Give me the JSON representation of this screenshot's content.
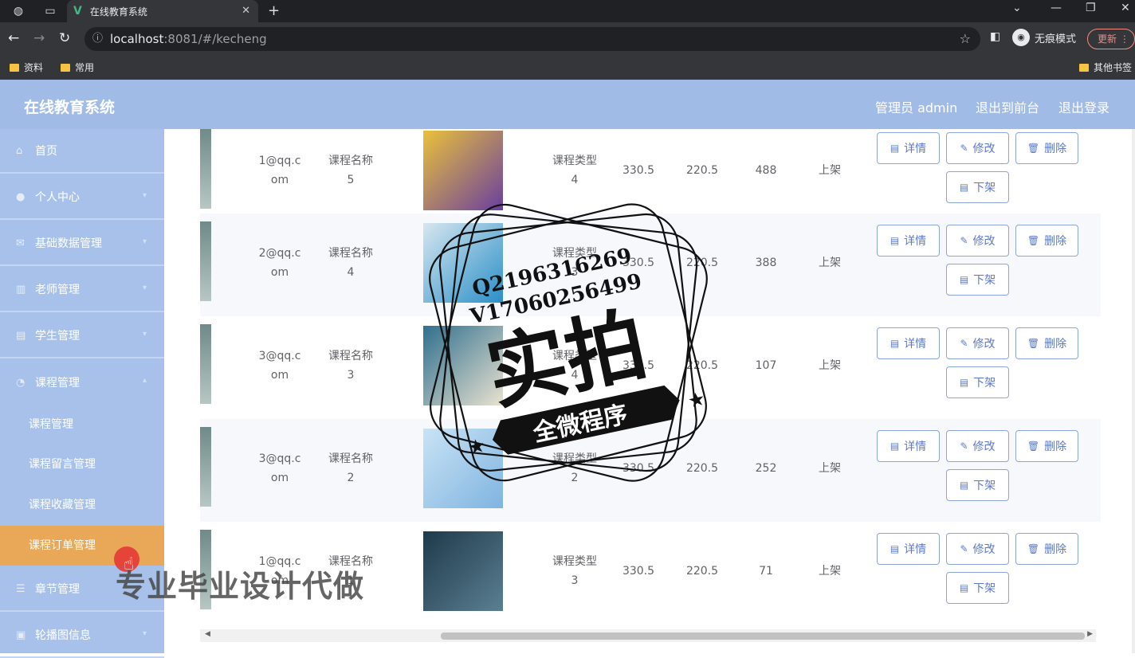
{
  "browser": {
    "tab_title": "在线教育系统",
    "url_host": "localhost",
    "url_rest": ":8081/#/kecheng",
    "incognito_label": "无痕模式",
    "update_label": "更新",
    "bookmarks": [
      "资料",
      "常用"
    ],
    "other_bookmarks": "其他书签"
  },
  "header": {
    "title": "在线教育系统",
    "user": "管理员 admin",
    "to_front": "退出到前台",
    "logout": "退出登录"
  },
  "sidebar": {
    "items": [
      {
        "label": "首页",
        "icon": "home-icon"
      },
      {
        "label": "个人中心",
        "icon": "user-icon"
      },
      {
        "label": "基础数据管理",
        "icon": "mail-icon"
      },
      {
        "label": "老师管理",
        "icon": "chart-icon"
      },
      {
        "label": "学生管理",
        "icon": "card-icon"
      },
      {
        "label": "课程管理",
        "icon": "clock-icon"
      }
    ],
    "sub_items": [
      "课程管理",
      "课程留言管理",
      "课程收藏管理",
      "课程订单管理"
    ],
    "after_items": [
      {
        "label": "章节管理",
        "icon": "menu-icon"
      },
      {
        "label": "轮播图信息",
        "icon": "image-icon"
      }
    ]
  },
  "table": {
    "rows": [
      {
        "email": [
          "1@qq.c",
          "om"
        ],
        "name": [
          "课程名称",
          "5"
        ],
        "type": [
          "课程类型",
          "4"
        ],
        "price": "330.5",
        "sale_price": "220.5",
        "clicks": "488",
        "status": "上架",
        "img_color": [
          "#e9c13a",
          "#6a3f9f"
        ]
      },
      {
        "email": [
          "2@qq.c",
          "om"
        ],
        "name": [
          "课程名称",
          "4"
        ],
        "type": [
          "课程类型",
          "3"
        ],
        "price": "330.5",
        "sale_price": "220.5",
        "clicks": "388",
        "status": "上架",
        "img_color": [
          "#d7e6ef",
          "#2a8fc8"
        ]
      },
      {
        "email": [
          "3@qq.c",
          "om"
        ],
        "name": [
          "课程名称",
          "3"
        ],
        "type": [
          "课程类型",
          "4"
        ],
        "price": "330.5",
        "sale_price": "220.5",
        "clicks": "107",
        "status": "上架",
        "img_color": [
          "#2f6f8e",
          "#e9e2d0"
        ]
      },
      {
        "email": [
          "3@qq.c",
          "om"
        ],
        "name": [
          "课程名称",
          "2"
        ],
        "type": [
          "课程类型",
          "2"
        ],
        "price": "330.5",
        "sale_price": "220.5",
        "clicks": "252",
        "status": "上架",
        "img_color": [
          "#c9e3f5",
          "#7fb4e0"
        ]
      },
      {
        "email": [
          "1@qq.c",
          "om"
        ],
        "name": [
          "课程名称",
          "1"
        ],
        "type": [
          "课程类型",
          "3"
        ],
        "price": "330.5",
        "sale_price": "220.5",
        "clicks": "71",
        "status": "上架",
        "img_color": [
          "#1e3a4a",
          "#5b7f92"
        ]
      }
    ],
    "buttons": {
      "detail": "详情",
      "edit": "修改",
      "delete": "删除",
      "offshelf": "下架"
    }
  },
  "overlays": {
    "stamp_contact_1": "Q2196316269",
    "stamp_contact_2": "V17060256499",
    "stamp_main": "实拍",
    "stamp_banner": "全微程序",
    "watermark": "专业毕业设计代做"
  }
}
